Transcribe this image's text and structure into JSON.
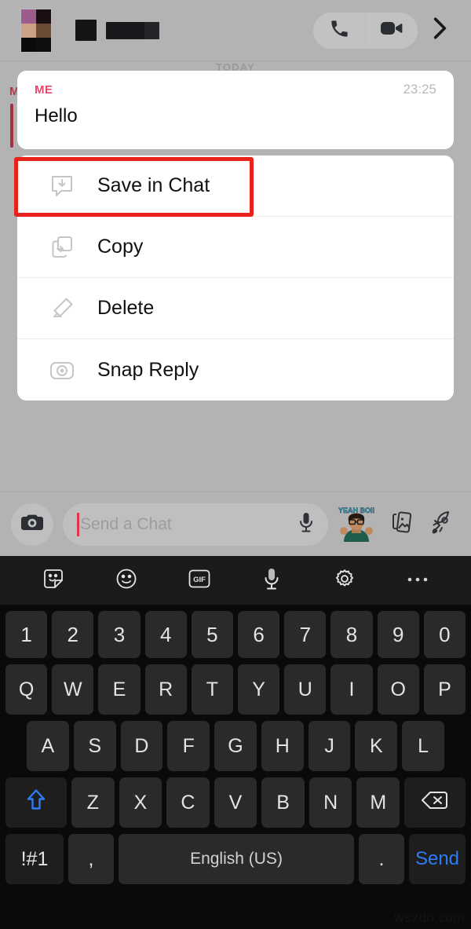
{
  "header": {
    "avatar_name": "avatar-redacted",
    "name_redacted": true,
    "phone_icon": "phone-icon",
    "video_icon": "video-camera-icon",
    "chevron_icon": "chevron-right-icon"
  },
  "chat": {
    "day_divider": "TODAY",
    "underlying_sender": "M",
    "message": {
      "sender": "ME",
      "time": "23:25",
      "text": "Hello"
    }
  },
  "context_menu": {
    "items": [
      {
        "label": "Save in Chat",
        "icon": "save-in-chat-icon",
        "highlighted": true
      },
      {
        "label": "Copy",
        "icon": "copy-icon",
        "highlighted": false
      },
      {
        "label": "Delete",
        "icon": "eraser-icon",
        "highlighted": false
      },
      {
        "label": "Snap Reply",
        "icon": "camera-icon",
        "highlighted": false
      }
    ],
    "highlight_color": "#e8211a"
  },
  "input_bar": {
    "camera_icon": "camera-icon",
    "placeholder": "Send a Chat",
    "value": "",
    "mic_icon": "microphone-icon",
    "bitmoji_icon": "bitmoji-sticker-icon",
    "stickers_icon": "sticker-cards-icon",
    "rocket_icon": "rocket-icon"
  },
  "keyboard": {
    "toolbar": [
      "sticker-icon",
      "emoji-icon",
      "gif-icon",
      "microphone-icon",
      "settings-gear-icon",
      "more-options-icon"
    ],
    "toolbar_labels": {
      "gif": "GIF"
    },
    "rows": {
      "numbers": [
        "1",
        "2",
        "3",
        "4",
        "5",
        "6",
        "7",
        "8",
        "9",
        "0"
      ],
      "top": [
        "Q",
        "W",
        "E",
        "R",
        "T",
        "Y",
        "U",
        "I",
        "O",
        "P"
      ],
      "home": [
        "A",
        "S",
        "D",
        "F",
        "G",
        "H",
        "J",
        "K",
        "L"
      ],
      "bottom": [
        "Z",
        "X",
        "C",
        "V",
        "B",
        "N",
        "M"
      ]
    },
    "shift_key": "shift-key",
    "backspace_key": "backspace-key",
    "symbols_key": "!#1",
    "comma_key": ",",
    "space_key": "English (US)",
    "period_key": ".",
    "send_key": "Send",
    "shift_color": "#2f7bf5",
    "send_color": "#2f7bf5"
  },
  "watermark": {
    "text": "wsxdn.com"
  }
}
